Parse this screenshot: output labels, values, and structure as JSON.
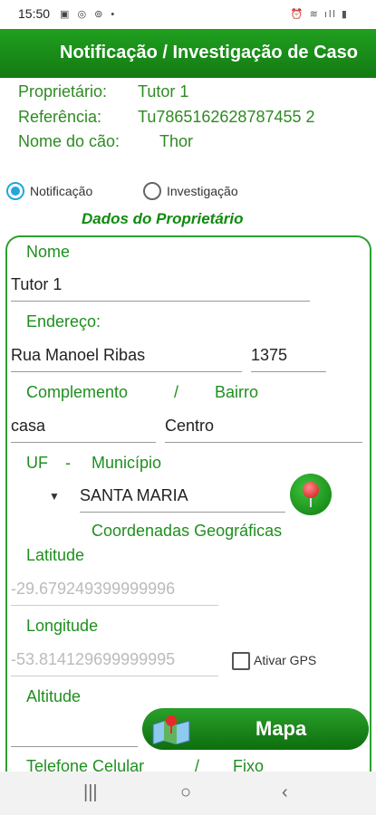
{
  "status_bar": {
    "time": "15:50",
    "left_icons": "▣ ◎ ⊚ •",
    "right_icons": "⏰ ≋ ıll ▮"
  },
  "header": {
    "title": "Notificação / Investigação de Caso"
  },
  "summary": {
    "proprietario_label": "Proprietário:",
    "proprietario_value": "Tutor 1",
    "referencia_label": "Referência:",
    "referencia_value": "Tu7865162628787455 2",
    "nome_cao_label": "Nome do cão:",
    "nome_cao_value": "Thor"
  },
  "type": {
    "notificacao": "Notificação",
    "investigacao": "Investigação",
    "selected": "notificacao"
  },
  "section_title": "Dados do Proprietário",
  "form": {
    "nome_label": "Nome",
    "nome_value": "Tutor 1",
    "endereco_label": "Endereço:",
    "rua_value": "Rua Manoel Ribas",
    "numero_value": "1375",
    "complemento_label": "Complemento",
    "slash": "/",
    "bairro_label": "Bairro",
    "complemento_value": "casa",
    "bairro_value": "Centro",
    "uf_label": "UF",
    "dash": "-",
    "municipio_label": "Município",
    "municipio_value": "SANTA MARIA",
    "coordenadas_label": "Coordenadas Geográficas",
    "latitude_label": "Latitude",
    "latitude_value": "-29.679249399999996",
    "longitude_label": "Longitude",
    "longitude_value": "-53.814129699999995",
    "gps_label": "Ativar GPS",
    "altitude_label": "Altitude",
    "altitude_value": "",
    "telefone_label": "Telefone Celular",
    "fixo_label": "Fixo"
  },
  "buttons": {
    "mapa": "Mapa"
  },
  "icons": {
    "location_pin": "map-pin-icon",
    "map": "map-icon",
    "dropdown": "dropdown-arrow-icon"
  },
  "colors": {
    "primary": "#137a13",
    "accent": "#20a6e0"
  }
}
